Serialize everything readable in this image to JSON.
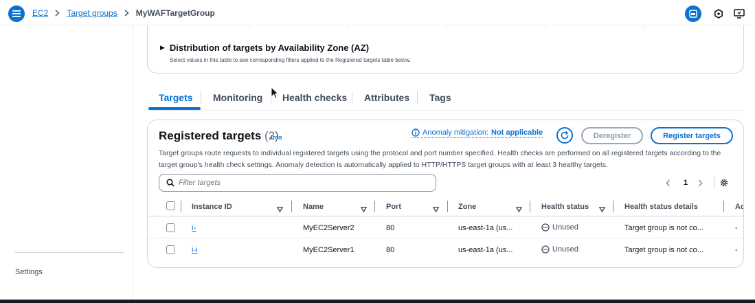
{
  "breadcrumb": {
    "service": "EC2",
    "section": "Target groups",
    "current": "MyWAFTargetGroup"
  },
  "topbar": {
    "icons": [
      "menu-icon",
      "panel-icon",
      "hexagon-icon",
      "monitor-icon"
    ],
    "accent": "#0972d3"
  },
  "sidebar": {
    "settings_label": "Settings"
  },
  "az_panel": {
    "title": "Distribution of targets by Availability Zone (AZ)",
    "subtitle": "Select values in this table to see corresponding filters applied to the Registered targets table below."
  },
  "tabs": [
    {
      "label": "Targets",
      "active": true
    },
    {
      "label": "Monitoring",
      "active": false
    },
    {
      "label": "Health checks",
      "active": false
    },
    {
      "label": "Attributes",
      "active": false
    },
    {
      "label": "Tags",
      "active": false
    }
  ],
  "registered": {
    "title": "Registered targets",
    "count": "(2)",
    "info_label": "Info",
    "anomaly_label": "Anomaly mitigation:",
    "anomaly_value": "Not applicable",
    "deregister_label": "Deregister",
    "register_label": "Register targets",
    "description": "Target groups route requests to individual registered targets using the protocol and port number specified. Health checks are performed on all registered targets according to the target group's health check settings. Anomaly detection is automatically applied to HTTP/HTTPS target groups with at least 3 healthy targets.",
    "filter_placeholder": "Filter targets",
    "page": "1",
    "columns": [
      "Instance ID",
      "Name",
      "Port",
      "Zone",
      "Health status",
      "Health status details",
      "Ad"
    ],
    "rows": [
      {
        "instance_id": "i-",
        "name": "MyEC2Server2",
        "port": "80",
        "zone": "us-east-1a (us...",
        "health": "Unused",
        "details": "Target group is not co...",
        "extra": "-"
      },
      {
        "instance_id": "i-i",
        "name": "MyEC2Server1",
        "port": "80",
        "zone": "us-east-1a (us...",
        "health": "Unused",
        "details": "Target group is not co...",
        "extra": "-"
      }
    ]
  }
}
